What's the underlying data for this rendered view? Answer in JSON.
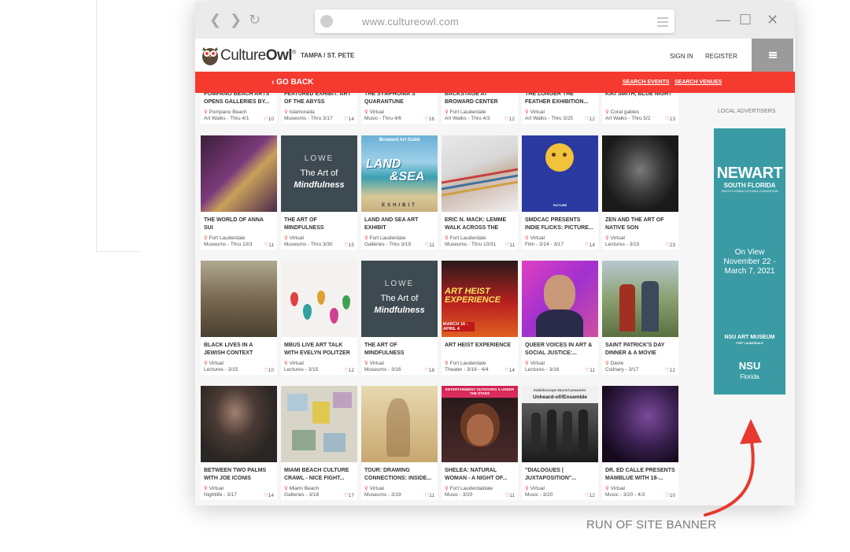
{
  "browser": {
    "url": "www.cultureowl.com",
    "back": "❮",
    "forward": "❯",
    "reload": "↻",
    "minimize": "—",
    "maximize": "☐",
    "close": "✕"
  },
  "header": {
    "logo_part1": "Culture",
    "logo_part2": "Owl",
    "logo_mark": "®",
    "city": "TAMPA / ST. PETE",
    "sign_in": "SIGN IN",
    "register": "REGISTER"
  },
  "subnav": {
    "go_back": "‹ GO BACK",
    "search_events": "SEARCH EVENTS",
    "search_venues": "SEARCH VENUES"
  },
  "cards": [
    {
      "title": "POMPANO BEACH ARTS OPENS GALLERIES BY...",
      "location": "Pompano Beach",
      "category": "Art Walks - Thru 4/1",
      "likes": "10"
    },
    {
      "title": "FEATURED EXHIBIT: ART OF THE ABYSS",
      "location": "Islamorada",
      "category": "Museums - Thru 3/17",
      "likes": "14"
    },
    {
      "title": "THE SYMPHONIA'S QUARANTUNE TUESDAYS",
      "location": "Virtual",
      "category": "Music - Thru 4/6",
      "likes": "16"
    },
    {
      "title": "BACKSTAGE AT BROWARD CENTER TOURS",
      "location": "Fort Lauderdale",
      "category": "Art Walks - Thru 4/3",
      "likes": "12"
    },
    {
      "title": "THE LONGER THE FEATHER EXHIBITION...",
      "location": "Virtual",
      "category": "Art Walks - Thru 3/25",
      "likes": "12"
    },
    {
      "title": "KIKI SMITH, BLUE NIGHT",
      "location": "Coral gables",
      "category": "Art Walks - Thru 5/2",
      "likes": "13"
    },
    {
      "title": "THE WORLD OF ANNA SUI",
      "location": "Fort Lauderdale",
      "category": "Museums - Thru 10/3",
      "likes": "11"
    },
    {
      "title": "THE ART OF MINDFULNESS",
      "location": "Virtual",
      "category": "Museums - Thru 3/30",
      "likes": "15"
    },
    {
      "title": "LAND AND SEA ART EXHIBIT",
      "location": "Fort Lauderdale",
      "category": "Galleries - Thru 3/19",
      "likes": "11"
    },
    {
      "title": "ERIC N. MACK: LEMME WALK ACROSS THE ROOM",
      "location": "Fort Lauderdale",
      "category": "Museums - Thru 10/31",
      "likes": "11"
    },
    {
      "title": "SMDCAC PRESENTS INDIE FLICKS: PICTURE...",
      "location": "Virtual",
      "category": "Film - 3/14 - 3/17",
      "likes": "14"
    },
    {
      "title": "ZEN AND THE ART OF NATIVE SON",
      "location": "Virtual",
      "category": "Lectures - 3/15",
      "likes": "23"
    },
    {
      "title": "BLACK LIVES IN A JEWISH CONTEXT COLOR AND...",
      "location": "Virtual",
      "category": "Lectures - 3/15",
      "likes": "10"
    },
    {
      "title": "MBUS LIVE ART TALK WITH EVELYN POLITZER",
      "location": "Virtual",
      "category": "Lectures - 3/15",
      "likes": "12"
    },
    {
      "title": "THE ART OF MINDFULNESS",
      "location": "Virtual",
      "category": "Museums - 3/16",
      "likes": "18"
    },
    {
      "title": "ART HEIST EXPERIENCE",
      "location": "Fort Lauderdale",
      "category": "Theater - 3/16 - 4/4",
      "likes": "14"
    },
    {
      "title": "QUEER VOICES IN ART & SOCIAL JUSTICE:...",
      "location": "Virtual",
      "category": "Lectures - 3/16",
      "likes": "11"
    },
    {
      "title": "SAINT PATRICK'S DAY DINNER & A MOVIE",
      "location": "Davie",
      "category": "Culinary - 3/17",
      "likes": "12"
    },
    {
      "title": "BETWEEN TWO PALMS WITH JOE ICONIS",
      "location": "Virtual",
      "category": "Nightlife - 3/17",
      "likes": "14"
    },
    {
      "title": "MIAMI BEACH CULTURE CRAWL - NICE FIGHT...",
      "location": "Miami Beach",
      "category": "Galleries - 3/18",
      "likes": "17"
    },
    {
      "title": "TOUR: DRAWING CONNECTIONS: INSIDE...",
      "location": "Virtual",
      "category": "Museums - 3/19",
      "likes": "11"
    },
    {
      "title": "SHELEA: NATURAL WOMAN - A NIGHT OF...",
      "location": "Fort Lauderdaldale",
      "category": "Music - 3/20",
      "likes": "11"
    },
    {
      "title": "\"DIALOGUES | JUXTAPOSITION\"...",
      "location": "Virtual",
      "category": "Music - 3/20",
      "likes": "12"
    },
    {
      "title": "DR. ED CALLE PRESENTS MAMBLUE WITH 18-...",
      "location": "Virtual",
      "category": "Music - 3/20 - 4/3",
      "likes": "10"
    }
  ],
  "image_text": {
    "lowe": "LOWE",
    "art_of": "The Art of",
    "mindfulness": "Mindfulness",
    "broward": "Broward Art Guild",
    "land": "LAND",
    "sea": "&SEA",
    "exhibit": "EXHIBIT",
    "picture": "PICTURE",
    "art_heist": "ART HEIST EXPERIENCE",
    "heist_dates": "MARCH 16 - APRIL 4",
    "entertainment": "ENTERTAINMENT OUTDOORS & UNDER THE STARS",
    "kaleidoscope": "Kaleidoscope MusArt presents:",
    "unheard": "Unheard-of//Ensemble"
  },
  "sidebar": {
    "label": "LOCAL ADVERTISERS",
    "ad_title": "NEWART",
    "ad_subtitle": "SOUTH FLORIDA",
    "ad_tagline": "SOUTH FLORIDA CULTURAL CONSORTIUM",
    "ad_on_view": "On View",
    "ad_dates1": "November 22 -",
    "ad_dates2": "March 7, 2021",
    "ad_museum": "NSU ART MUSEUM",
    "ad_museum_city": "FORT LAUDERDALE",
    "ad_nsu": "NSU",
    "ad_florida": "Florida"
  },
  "caption": "RUN OF SITE BANNER",
  "colors": {
    "accent_red": "#f53a2f",
    "ad_teal": "#3a9ba4",
    "menu_gray": "#9b9b9b"
  }
}
